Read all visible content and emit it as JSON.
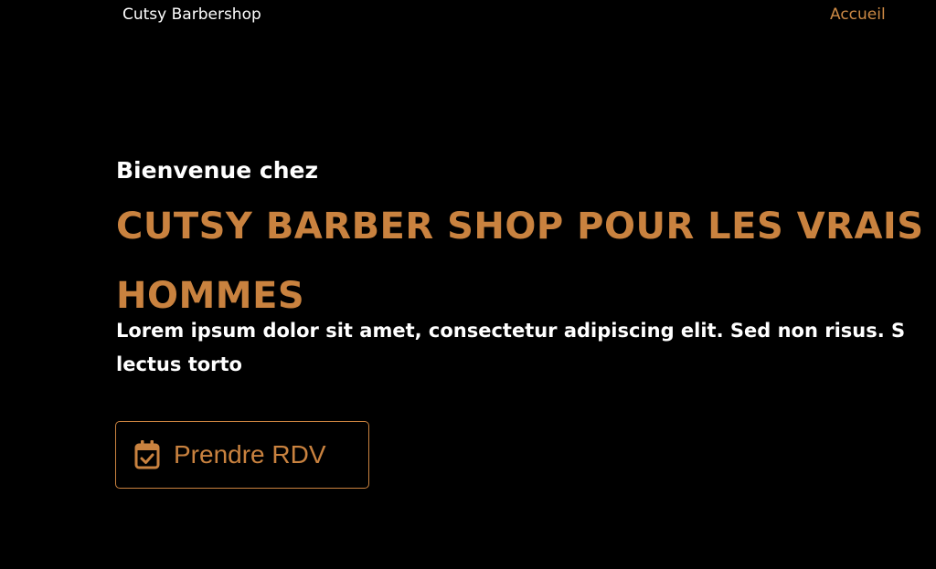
{
  "colors": {
    "background": "#000000",
    "accent": "#c9823f",
    "text": "#ffffff"
  },
  "navbar": {
    "brand": "Cutsy Barbershop",
    "links": [
      {
        "label": "Accueil",
        "active": true
      }
    ]
  },
  "hero": {
    "welcome": "Bienvenue chez",
    "headline_lines": [
      "CUTSY BARBER SHOP POUR LES VRAIS",
      "HOMMES"
    ],
    "lead_lines": [
      "Lorem ipsum dolor sit amet, consectetur adipiscing elit. Sed non risus. S",
      "lectus torto"
    ],
    "cta": {
      "label": "Prendre RDV",
      "icon": "calendar-check-icon"
    }
  }
}
